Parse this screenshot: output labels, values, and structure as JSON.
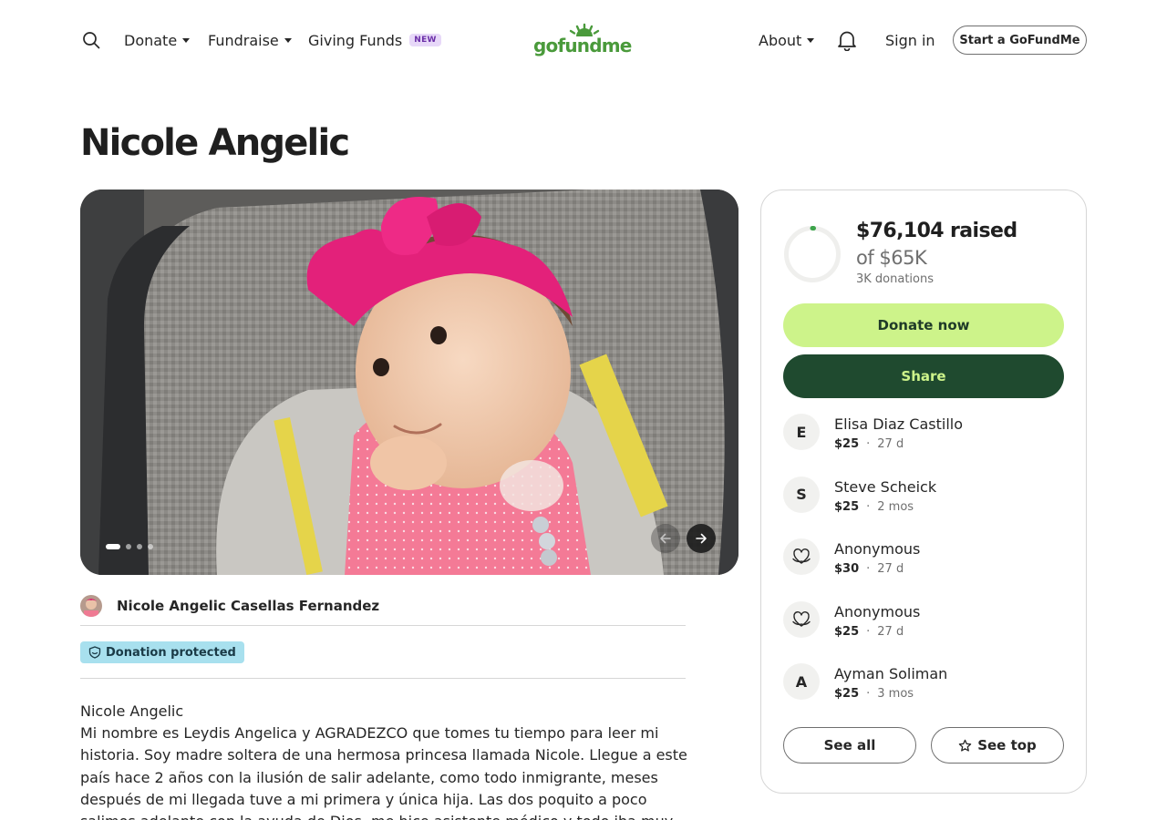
{
  "header": {
    "nav": {
      "donate": "Donate",
      "fundraise": "Fundraise",
      "giving_funds": "Giving Funds",
      "new_badge": "NEW",
      "about": "About",
      "sign_in": "Sign in",
      "start": "Start a GoFundMe"
    },
    "logo_text": "gofundme",
    "icons": [
      "search-icon",
      "bell-icon"
    ]
  },
  "campaign": {
    "title": "Nicole Angelic",
    "organizer": "Nicole Angelic Casellas Fernandez",
    "protection_badge": "Donation protected",
    "story_title": "Nicole Angelic",
    "story": "Mi nombre es Leydis Angelica y AGRADEZCO que tomes tu tiempo para leer mi historia. Soy madre soltera de una hermosa princesa llamada Nicole. Llegue a este país hace 2 años con la ilusión de salir adelante, como todo inmigrante, meses después de mi llegada tuve a mi primera y única hija. Las dos poquito a poco salimos adelante con la ayuda de Dios, me hice asistente médico y todo iba muy bien yo estaba trabajando y estábamos felices mi"
  },
  "carousel": {
    "total_slides": 4,
    "active_slide": 1
  },
  "progress": {
    "raised": "$76,104 raised",
    "goal": "of $65K",
    "donations": "3K donations",
    "ring_color": "#3da44b"
  },
  "actions": {
    "donate": "Donate now",
    "share": "Share",
    "see_all": "See all",
    "see_top": "See top"
  },
  "donors": [
    {
      "initial": "E",
      "name": "Elisa Diaz Castillo",
      "amount": "$25",
      "time": "27 d",
      "anonymous": false
    },
    {
      "initial": "S",
      "name": "Steve Scheick",
      "amount": "$25",
      "time": "2 mos",
      "anonymous": false
    },
    {
      "initial": "",
      "name": "Anonymous",
      "amount": "$30",
      "time": "27 d",
      "anonymous": true
    },
    {
      "initial": "",
      "name": "Anonymous",
      "amount": "$25",
      "time": "27 d",
      "anonymous": true
    },
    {
      "initial": "A",
      "name": "Ayman Soliman",
      "amount": "$25",
      "time": "3 mos",
      "anonymous": false
    }
  ],
  "colors": {
    "donate_button": "#cdf38a",
    "share_button": "#1f4a2f",
    "badge": "#a8e0ee",
    "brand": "#4a9a3b"
  }
}
